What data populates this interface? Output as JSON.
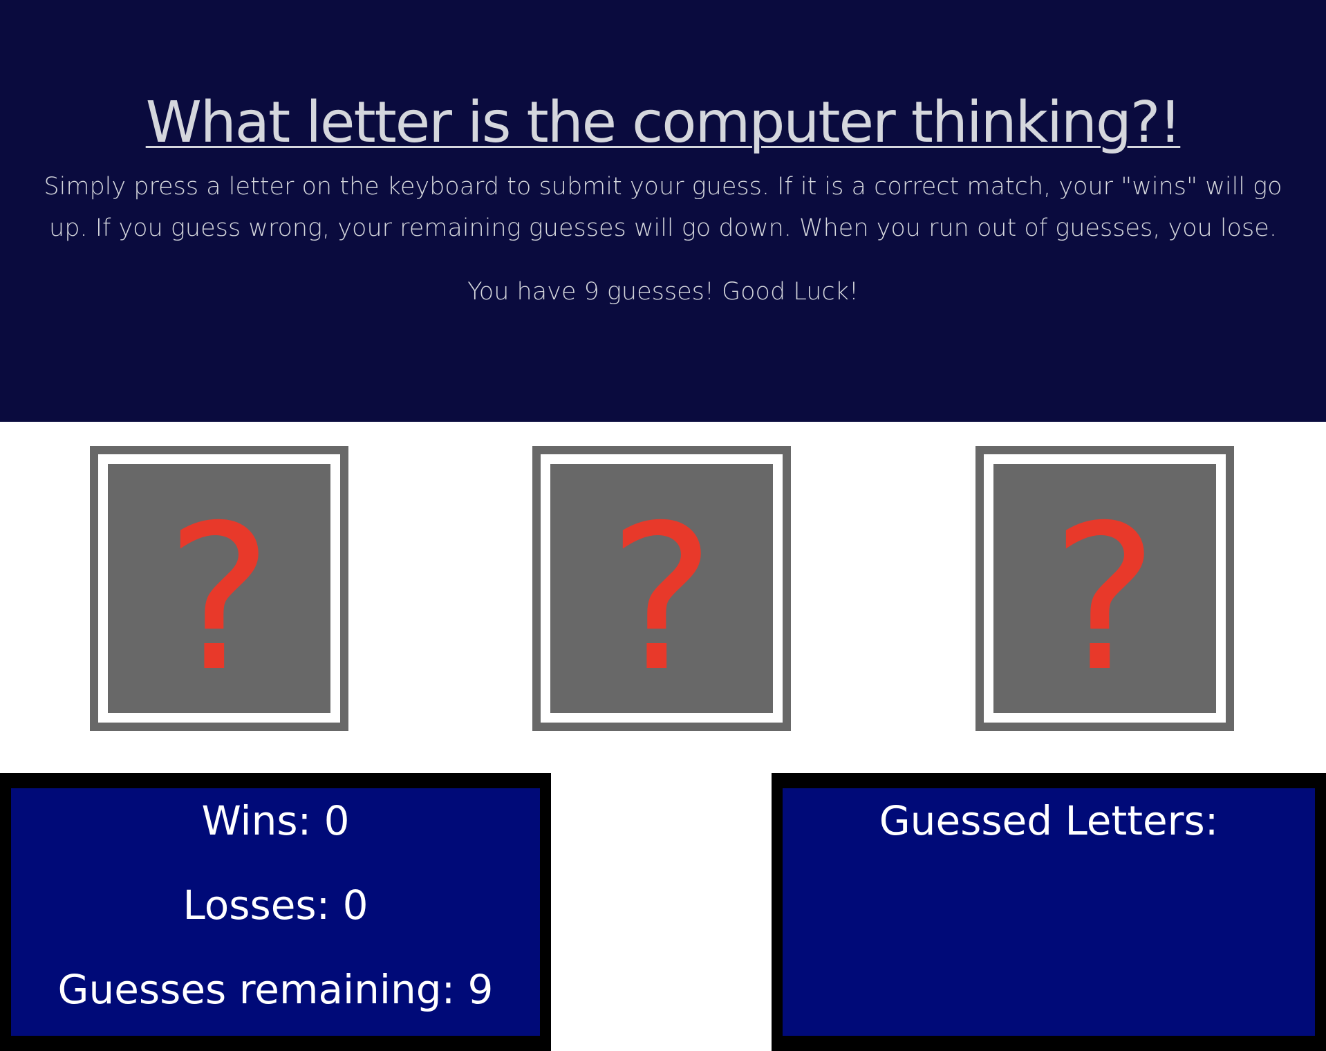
{
  "header": {
    "title": "What letter is the computer thinking?!",
    "description": "Simply press a letter on the keyboard to submit your guess. If it is a correct match, your \"wins\" will go up. If you guess wrong, your remaining guesses will go down. When you run out of guesses, you lose.",
    "good_luck": "You have 9 guesses! Good Luck!"
  },
  "cards": [
    {
      "symbol": "?",
      "icon": "question-mark-icon"
    },
    {
      "symbol": "?",
      "icon": "question-mark-icon"
    },
    {
      "symbol": "?",
      "icon": "question-mark-icon"
    }
  ],
  "stats": {
    "wins_label": "Wins: 0",
    "losses_label": "Losses: 0",
    "guesses_label": "Guesses remaining: 9"
  },
  "guessed": {
    "title": "Guessed Letters:",
    "letters": ""
  },
  "colors": {
    "header_bg": "#0a0b3e",
    "panel_bg": "#000a78",
    "card_grey": "#686868",
    "question_red": "#e8392a"
  }
}
